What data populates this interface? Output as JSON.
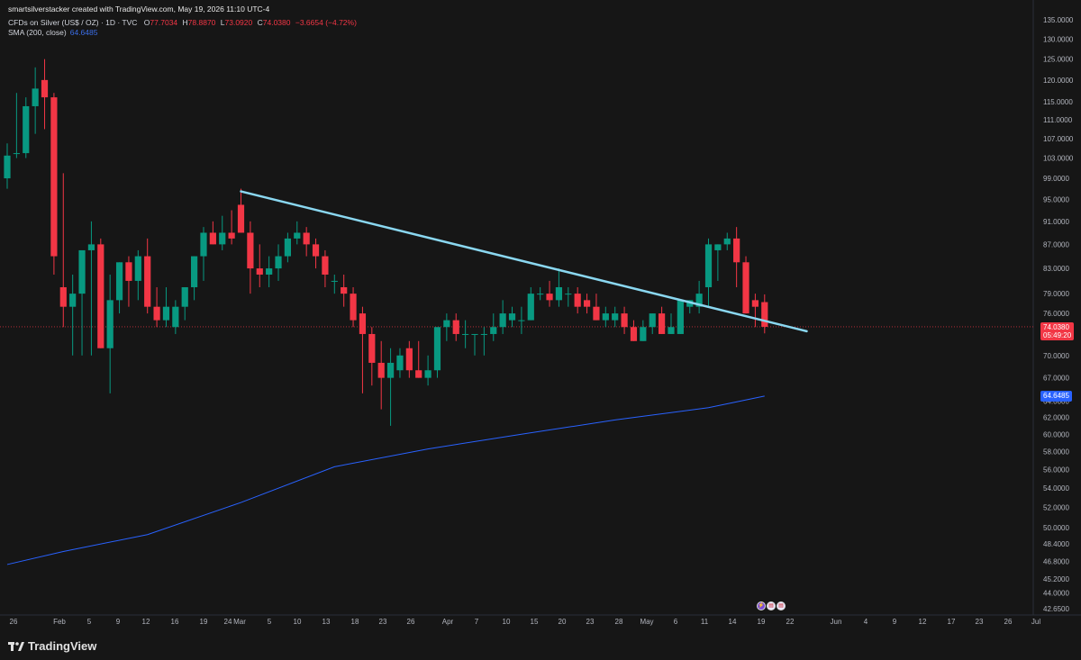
{
  "header": {
    "credit": "smartsilverstacker created with TradingView.com, May 19, 2026 11:10 UTC-4",
    "symbol": "CFDs on Silver (US$ / OZ) · 1D · TVC",
    "ohlc": {
      "open_label": "O",
      "open": "77.7034",
      "high_label": "H",
      "high": "78.8870",
      "low_label": "L",
      "low": "73.0920",
      "close_label": "C",
      "close": "74.0380",
      "change": "−3.6654 (−4.72%)"
    },
    "indicator_name": "SMA (200, close)",
    "indicator_value": "64.6485"
  },
  "price_tags": {
    "last_price": "74.0380",
    "countdown": "05:49:20",
    "sma": "64.6485"
  },
  "branding": {
    "logo_text": "TradingView"
  },
  "events": [
    "lightning-icon",
    "us-flag-icon",
    "us-flag-icon"
  ],
  "colors": {
    "background": "#161616",
    "up": "#089981",
    "down": "#f23645",
    "sma": "#2962ff",
    "trendline": "#8ad7f0"
  },
  "chart_data": {
    "type": "candlestick",
    "symbol": "CFDs on Silver (US$ / OZ)",
    "interval": "1D",
    "y_axis": {
      "scale": "log",
      "tick_labels": [
        "135.0000",
        "130.0000",
        "125.0000",
        "120.0000",
        "115.0000",
        "111.0000",
        "107.0000",
        "103.0000",
        "99.0000",
        "95.0000",
        "91.0000",
        "87.0000",
        "83.0000",
        "79.0000",
        "76.0000",
        "73.0000",
        "70.0000",
        "67.0000",
        "64.0000",
        "62.0000",
        "60.0000",
        "58.0000",
        "56.0000",
        "54.0000",
        "52.0000",
        "50.0000",
        "48.4000",
        "46.8000",
        "45.2000",
        "44.0000",
        "42.6500"
      ],
      "range": [
        42.5,
        137
      ]
    },
    "x_axis": {
      "tick_labels": [
        "26",
        "Feb",
        "5",
        "9",
        "12",
        "16",
        "19",
        "24",
        "Mar",
        "5",
        "10",
        "13",
        "18",
        "23",
        "26",
        "Apr",
        "7",
        "10",
        "15",
        "20",
        "23",
        "28",
        "May",
        "6",
        "11",
        "14",
        "19",
        "22",
        "Jun",
        "4",
        "9",
        "12",
        "17",
        "23",
        "26",
        "Jul"
      ]
    },
    "dates": [
      "2026-01-26",
      "2026-01-27",
      "2026-01-28",
      "2026-01-29",
      "2026-01-30",
      "2026-02-02",
      "2026-02-03",
      "2026-02-04",
      "2026-02-05",
      "2026-02-06",
      "2026-02-09",
      "2026-02-10",
      "2026-02-11",
      "2026-02-12",
      "2026-02-13",
      "2026-02-16",
      "2026-02-17",
      "2026-02-18",
      "2026-02-19",
      "2026-02-20",
      "2026-02-23",
      "2026-02-24",
      "2026-02-25",
      "2026-02-26",
      "2026-02-27",
      "2026-03-02",
      "2026-03-03",
      "2026-03-04",
      "2026-03-05",
      "2026-03-06",
      "2026-03-09",
      "2026-03-10",
      "2026-03-11",
      "2026-03-12",
      "2026-03-13",
      "2026-03-16",
      "2026-03-17",
      "2026-03-18",
      "2026-03-19",
      "2026-03-20",
      "2026-03-23",
      "2026-03-24",
      "2026-03-25",
      "2026-03-26",
      "2026-03-27",
      "2026-03-30",
      "2026-03-31",
      "2026-04-01",
      "2026-04-02",
      "2026-04-03",
      "2026-04-06",
      "2026-04-07",
      "2026-04-08",
      "2026-04-09",
      "2026-04-10",
      "2026-04-13",
      "2026-04-14",
      "2026-04-15",
      "2026-04-16",
      "2026-04-17",
      "2026-04-20",
      "2026-04-21",
      "2026-04-22",
      "2026-04-23",
      "2026-04-24",
      "2026-04-27",
      "2026-04-28",
      "2026-04-29",
      "2026-04-30",
      "2026-05-01",
      "2026-05-04",
      "2026-05-05",
      "2026-05-06",
      "2026-05-07",
      "2026-05-08",
      "2026-05-11",
      "2026-05-12",
      "2026-05-13",
      "2026-05-14",
      "2026-05-15",
      "2026-05-18",
      "2026-05-19"
    ],
    "candles": [
      [
        99,
        106,
        97,
        103.5
      ],
      [
        104,
        117,
        103,
        104
      ],
      [
        104,
        116,
        103,
        114
      ],
      [
        114,
        123,
        108,
        118
      ],
      [
        120,
        125,
        109,
        116
      ],
      [
        116,
        117,
        82,
        85
      ],
      [
        80,
        100,
        74,
        77
      ],
      [
        77,
        82,
        70,
        79
      ],
      [
        79,
        82,
        70,
        86
      ],
      [
        86,
        91,
        70,
        87
      ],
      [
        87,
        88,
        71,
        71
      ],
      [
        71,
        82,
        65,
        78
      ],
      [
        78,
        84,
        76,
        84
      ],
      [
        84,
        85,
        77,
        81
      ],
      [
        81,
        86,
        78,
        85
      ],
      [
        85,
        88,
        76,
        77
      ],
      [
        77,
        80,
        74,
        75
      ],
      [
        75,
        80,
        74,
        77
      ],
      [
        74,
        78,
        73,
        77
      ],
      [
        77,
        80,
        75,
        80
      ],
      [
        80,
        85,
        78,
        85
      ],
      [
        85,
        90,
        81,
        89
      ],
      [
        89,
        91,
        87,
        87
      ],
      [
        87,
        92,
        86,
        89
      ],
      [
        89,
        93,
        87,
        88
      ],
      [
        94,
        97,
        92,
        89
      ],
      [
        89,
        91,
        79,
        83
      ],
      [
        83,
        87,
        80,
        82
      ],
      [
        82,
        85,
        80,
        83
      ],
      [
        83,
        87,
        81,
        85
      ],
      [
        85,
        89,
        84,
        88
      ],
      [
        88,
        91,
        87,
        89
      ],
      [
        89,
        90,
        85,
        87
      ],
      [
        87,
        88,
        83,
        85
      ],
      [
        85,
        86,
        80,
        82
      ],
      [
        81,
        82,
        79,
        81
      ],
      [
        80,
        82,
        77,
        79
      ],
      [
        79,
        80,
        74,
        75
      ],
      [
        76,
        77,
        65,
        73
      ],
      [
        73,
        74,
        66,
        69
      ],
      [
        69,
        72,
        63,
        67
      ],
      [
        67,
        71,
        61,
        69
      ],
      [
        68,
        71,
        67,
        70
      ],
      [
        71,
        72,
        67,
        68
      ],
      [
        68,
        72,
        67,
        67
      ],
      [
        67,
        70,
        66,
        68
      ],
      [
        68,
        73,
        67,
        74
      ],
      [
        74,
        76,
        72,
        75
      ],
      [
        75,
        76,
        72,
        73
      ],
      [
        73,
        75,
        71,
        73
      ],
      [
        73,
        73,
        70,
        73
      ],
      [
        73,
        74,
        70,
        73
      ],
      [
        73,
        76,
        72,
        74
      ],
      [
        74,
        78,
        73,
        76
      ],
      [
        75,
        77,
        74,
        76
      ],
      [
        75,
        77,
        73,
        75
      ],
      [
        75,
        80,
        75,
        79
      ],
      [
        79,
        80,
        78,
        79
      ],
      [
        79,
        81,
        77,
        78
      ],
      [
        78,
        83,
        77,
        80
      ],
      [
        79,
        80,
        77,
        79
      ],
      [
        79,
        80,
        76,
        77
      ],
      [
        78,
        79,
        76,
        77
      ],
      [
        77,
        79,
        75,
        75
      ],
      [
        75,
        77,
        74,
        76
      ],
      [
        75,
        77,
        74,
        76
      ],
      [
        76,
        77,
        73,
        74
      ],
      [
        74,
        75,
        72,
        72
      ],
      [
        72,
        75,
        72,
        74
      ],
      [
        74,
        76,
        73,
        76
      ],
      [
        76,
        77,
        73,
        73
      ],
      [
        73,
        76,
        73,
        74
      ],
      [
        73,
        78,
        73,
        78
      ],
      [
        77,
        78,
        76,
        78
      ],
      [
        77,
        81,
        76,
        79
      ],
      [
        80,
        88,
        77,
        87
      ],
      [
        86,
        87,
        81,
        87
      ],
      [
        87,
        89,
        86,
        88
      ],
      [
        88,
        90,
        80,
        84
      ],
      [
        84,
        85,
        76,
        76
      ],
      [
        78,
        79,
        74,
        77
      ],
      [
        77.7034,
        78.887,
        73.092,
        74.038
      ]
    ],
    "sma200": {
      "name": "SMA (200, close)",
      "points": [
        [
          0,
          46.5
        ],
        [
          6,
          47.7
        ],
        [
          15,
          49.3
        ],
        [
          25,
          52.5
        ],
        [
          35,
          56.3
        ],
        [
          45,
          58.3
        ],
        [
          55,
          60
        ],
        [
          65,
          61.7
        ],
        [
          75,
          63.2
        ],
        [
          81,
          64.6485
        ]
      ]
    },
    "trendline": {
      "from": {
        "index": 25,
        "price": 96.5
      },
      "to": {
        "index": 85.5,
        "price": 73.4
      }
    },
    "last_price": 74.038,
    "ylim": [
      42.5,
      137
    ]
  }
}
